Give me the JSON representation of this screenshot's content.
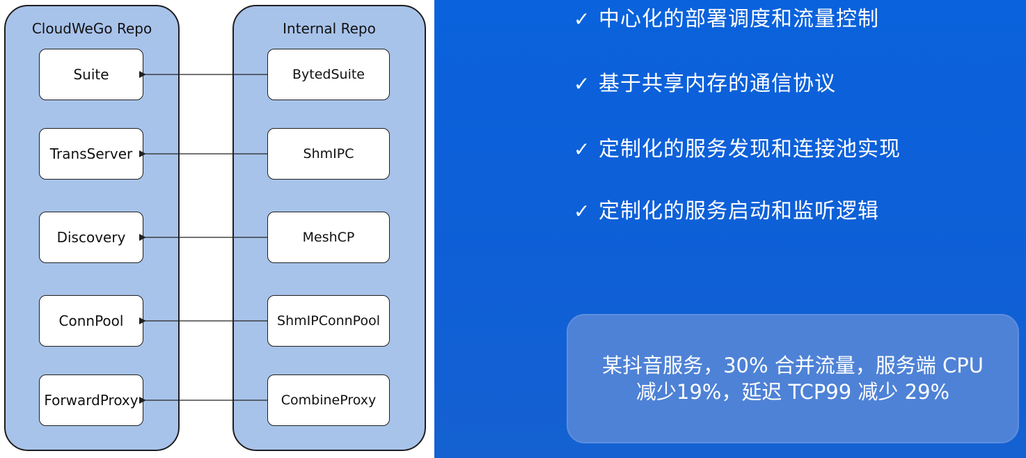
{
  "diagram": {
    "cloudwego_repo": {
      "title": "CloudWeGo Repo",
      "items": [
        "Suite",
        "TransServer",
        "Discovery",
        "ConnPool",
        "ForwardProxy"
      ]
    },
    "internal_repo": {
      "title": "Internal Repo",
      "items": [
        "BytedSuite",
        "ShmIPC",
        "MeshCP",
        "ShmIPConnPool",
        "CombineProxy"
      ]
    }
  },
  "features": [
    {
      "icon": "check-icon",
      "check": "✓",
      "text": "中心化的部署调度和流量控制"
    },
    {
      "icon": "check-icon",
      "check": "✓",
      "text": "基于共享内存的通信协议"
    },
    {
      "icon": "check-icon",
      "check": "✓",
      "text": "定制化的服务发现和连接池实现"
    },
    {
      "icon": "check-icon",
      "check": "✓",
      "text": "定制化的服务启动和监听逻辑"
    }
  ],
  "callout": {
    "line1": "某抖音服务，30% 合并流量，服务端 CPU",
    "line2": "减少19%，延迟 TCP99 减少 29%"
  },
  "colors": {
    "panel_blue": "#0a62dc",
    "repo_fill": "#a8c3ea",
    "callout_fill": "#4e82d6"
  }
}
